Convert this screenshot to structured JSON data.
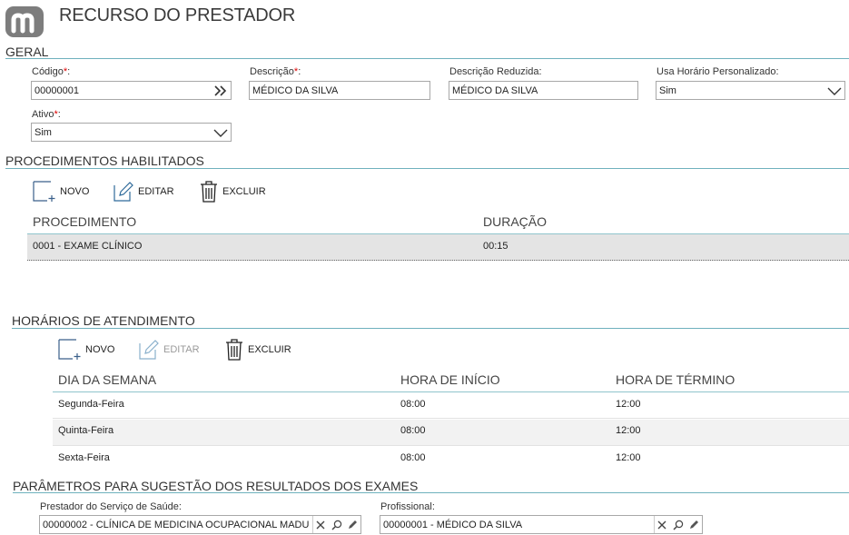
{
  "page": {
    "title": "RECURSO DO PRESTADOR"
  },
  "geral": {
    "section_title": "GERAL",
    "codigo": {
      "label": "Código",
      "required_mark": "*",
      "value": "00000001"
    },
    "descricao": {
      "label": "Descrição",
      "required_mark": "*",
      "value": "MÉDICO DA SILVA"
    },
    "descricao_reduzida": {
      "label": "Descrição Reduzida",
      "value": "MÉDICO DA SILVA"
    },
    "usa_horario": {
      "label": "Usa Horário Personalizado",
      "value": "Sim"
    },
    "ativo": {
      "label": "Ativo",
      "required_mark": "*",
      "value": "Sim"
    },
    "colon": ":"
  },
  "procedimentos": {
    "section_title": "PROCEDIMENTOS HABILITADOS",
    "toolbar": {
      "novo": "NOVO",
      "editar": "EDITAR",
      "excluir": "EXCLUIR"
    },
    "columns": [
      "PROCEDIMENTO",
      "DURAÇÃO"
    ],
    "rows": [
      {
        "procedimento": "0001 - EXAME CLÍNICO",
        "duracao": "00:15"
      }
    ]
  },
  "horarios": {
    "section_title": "HORÁRIOS DE ATENDIMENTO",
    "toolbar": {
      "novo": "NOVO",
      "editar": "EDITAR",
      "excluir": "EXCLUIR"
    },
    "columns": [
      "DIA DA SEMANA",
      "HORA DE INÍCIO",
      "HORA DE TÉRMINO"
    ],
    "rows": [
      {
        "dia": "Segunda-Feira",
        "inicio": "08:00",
        "termino": "12:00"
      },
      {
        "dia": "Quinta-Feira",
        "inicio": "08:00",
        "termino": "12:00"
      },
      {
        "dia": "Sexta-Feira",
        "inicio": "08:00",
        "termino": "12:00"
      }
    ]
  },
  "parametros": {
    "section_title": "PARÂMETROS PARA SUGESTÃO DOS RESULTADOS DOS EXAMES",
    "prestador": {
      "label": "Prestador do Serviço de Saúde:",
      "value": "00000002 - CLÍNICA DE MEDICINA OCUPACIONAL MADU"
    },
    "profissional": {
      "label": "Profissional:",
      "value": "00000001 - MÉDICO DA SILVA"
    }
  },
  "icons": {
    "logo": "m-logo",
    "lookup": "double-chevron-right-icon",
    "dropdown": "chevron-down-icon",
    "new": "new-document-icon",
    "edit": "pencil-icon",
    "delete": "trash-icon",
    "clear": "close-icon",
    "search": "search-icon"
  },
  "colors": {
    "section_line": "#6fb1bd",
    "required": "#dd0000",
    "selected_row": "#e4e4e4"
  }
}
